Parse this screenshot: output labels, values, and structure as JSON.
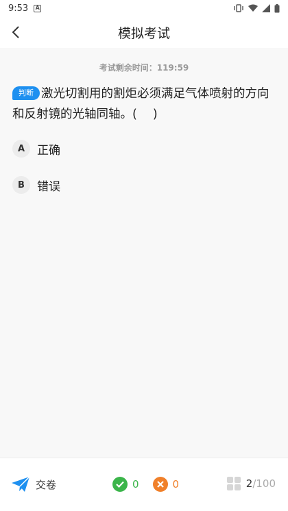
{
  "status_bar": {
    "time": "9:53",
    "notification_letter": "A"
  },
  "header": {
    "title": "模拟考试"
  },
  "exam": {
    "timer_label": "考试剩余时间：",
    "timer_value": "119:59",
    "question_type": "判断",
    "question_text": "激光切割用的割炬必须满足气体喷射的方向和反射镜的光轴同轴。(　 )",
    "options": [
      {
        "letter": "A",
        "text": "正确"
      },
      {
        "letter": "B",
        "text": "错误"
      }
    ]
  },
  "bottom_bar": {
    "submit_label": "交卷",
    "correct_count": "0",
    "wrong_count": "0",
    "current_question": "2",
    "total_questions": "/100"
  },
  "colors": {
    "accent": "#1e90f0",
    "correct": "#3bb54a",
    "wrong": "#f0802a"
  }
}
